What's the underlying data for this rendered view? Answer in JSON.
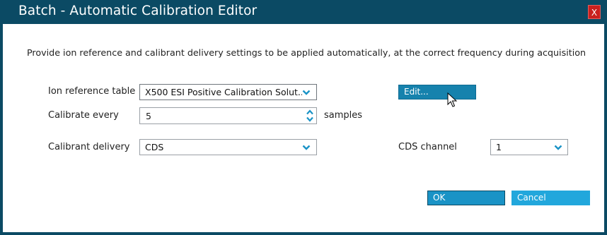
{
  "window": {
    "title": "Batch - Automatic Calibration Editor",
    "close_label": "X"
  },
  "description": "Provide ion reference and calibrant delivery settings to be applied automatically, at the correct frequency during acquisition",
  "fields": {
    "ion_reference": {
      "label": "Ion reference table",
      "value": "X500 ESI Positive Calibration Solut..."
    },
    "calibrate_every": {
      "label": "Calibrate every",
      "value": "5",
      "unit": "samples"
    },
    "calibrant_delivery": {
      "label": "Calibrant delivery",
      "value": "CDS"
    },
    "cds_channel": {
      "label": "CDS channel",
      "value": "1"
    }
  },
  "buttons": {
    "edit": "Edit...",
    "ok": "OK",
    "cancel": "Cancel"
  },
  "colors": {
    "titlebar": "#0b4a64",
    "accent": "#1a93c6",
    "close": "#c9201e"
  },
  "icons": {
    "dropdown": "chevron-down-icon",
    "spin_up": "caret-up-icon",
    "spin_down": "caret-down-icon",
    "close": "close-icon",
    "cursor": "mouse-pointer-icon"
  }
}
